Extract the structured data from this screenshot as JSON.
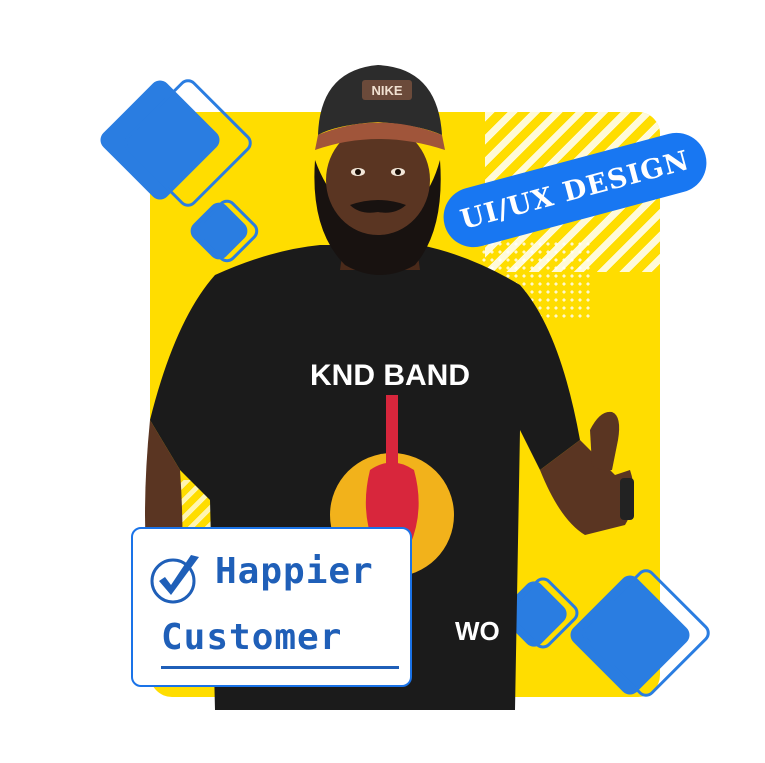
{
  "badge": {
    "text": "UI/UX DESIGN"
  },
  "shirt": {
    "band_text": "KND BAND",
    "bottom_text": "WO"
  },
  "cap": {
    "logo_text": "NIKE"
  },
  "card": {
    "line1": "Happier",
    "line2": "Customer"
  },
  "colors": {
    "yellow": "#ffdd00",
    "blue": "#1877f2",
    "card_text": "#1f5fb8",
    "shirt": "#1b1b1b",
    "skin": "#5a3522"
  }
}
